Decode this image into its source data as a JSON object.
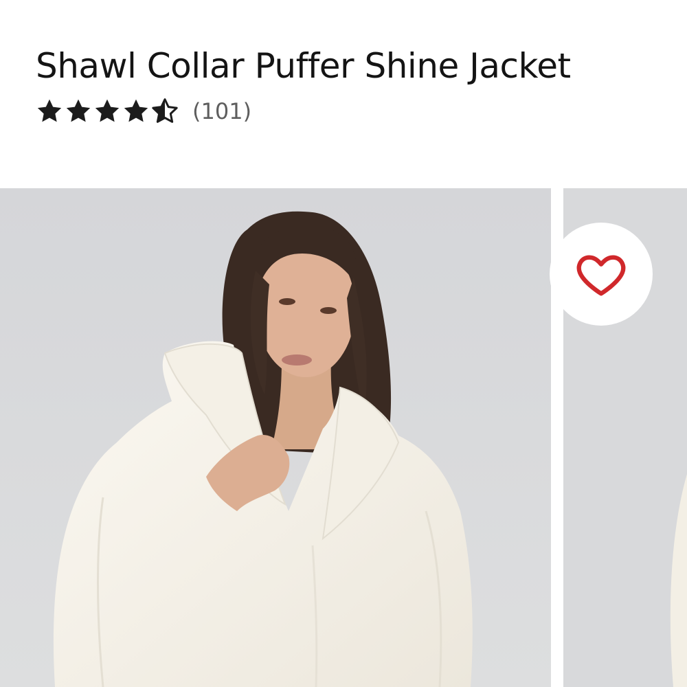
{
  "product": {
    "title": "Shawl Collar Puffer Shine Jacket",
    "rating": {
      "value": 4.5,
      "max": 5,
      "count_label": "(101)"
    }
  },
  "gallery": {
    "favorite_icon": "heart-outline-icon",
    "favorite_color": "#d0282b",
    "background_color": "#d9dadc",
    "jacket_color": "#f5f2ea"
  }
}
